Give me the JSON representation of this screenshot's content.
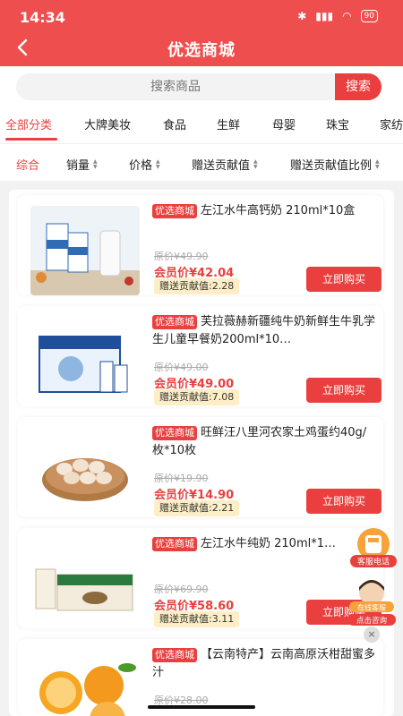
{
  "status_bar": {
    "time": "14:34",
    "battery": "90"
  },
  "header": {
    "title": "优选商城"
  },
  "search": {
    "placeholder": "搜索商品",
    "button": "搜索"
  },
  "categories": [
    "全部分类",
    "大牌美妆",
    "食品",
    "生鲜",
    "母婴",
    "珠宝",
    "家纺"
  ],
  "sort_options": [
    "综合",
    "销量",
    "价格",
    "赠送贡献值",
    "赠送贡献值比例"
  ],
  "products": [
    {
      "tag": "优选商城",
      "name": "左江水牛高钙奶 210ml*10盒",
      "original_price": "原价¥49.90",
      "member_price": "会员价¥42.04",
      "contribution": "赠送贡献值:2.28",
      "buy": "立即购买"
    },
    {
      "tag": "优选商城",
      "name": "芙拉薇赫新疆纯牛奶新鲜生牛乳学生儿童早餐奶200ml*10…",
      "original_price": "原价¥49.00",
      "member_price": "会员价¥49.00",
      "contribution": "赠送贡献值:7.08",
      "buy": "立即购买"
    },
    {
      "tag": "优选商城",
      "name": "旺鲜汪八里河农家土鸡蛋约40g/枚*10枚",
      "original_price": "原价¥19.90",
      "member_price": "会员价¥14.90",
      "contribution": "赠送贡献值:2.21",
      "buy": "立即购买"
    },
    {
      "tag": "优选商城",
      "name": "左江水牛纯奶 210ml*1…",
      "original_price": "原价¥69.90",
      "member_price": "会员价¥58.60",
      "contribution": "赠送贡献值:3.11",
      "buy": "立即购买"
    },
    {
      "tag": "优选商城",
      "name": "【云南特产】云南高原沃柑甜蜜多汁",
      "original_price": "原价¥28.00"
    }
  ],
  "floating": {
    "phone_label": "客服电话",
    "service_top": "在线客服",
    "service_bottom": "点击咨询",
    "close": "×"
  },
  "colors": {
    "brand": "#ef4e4e",
    "accent": "#e9403f"
  }
}
